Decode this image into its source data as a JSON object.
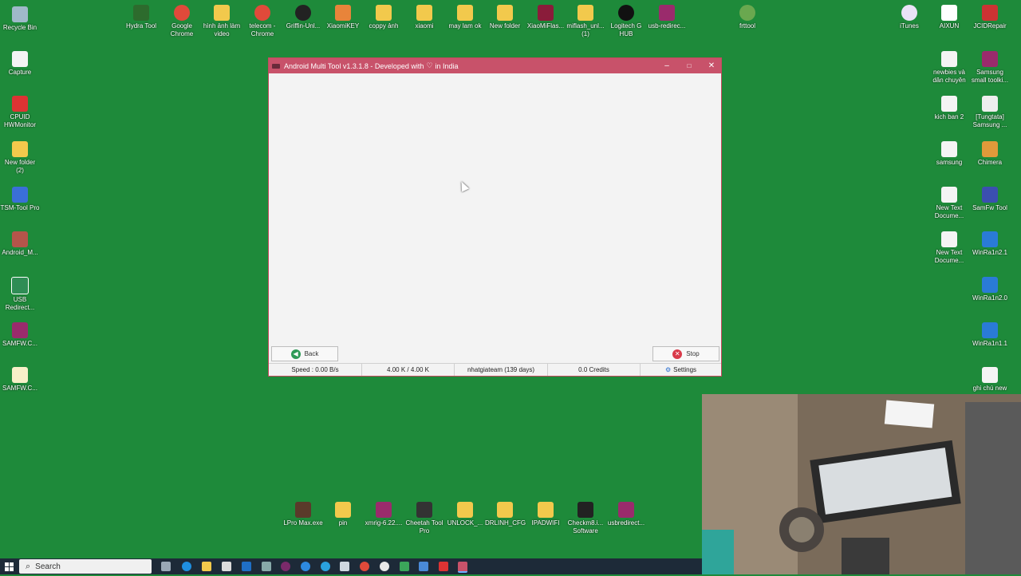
{
  "desktop": {
    "top_row": [
      "Hydra Tool",
      "Google Chrome",
      "hình ảnh làm video",
      "telecom - Chrome",
      "Griffin-Unl...",
      "XiaomiKEY",
      "coppy ảnh",
      "xiaomi",
      "may lam ok",
      "New folder",
      "XiaoMiFlas...",
      "miflash_unl... (1)",
      "Logitech G HUB",
      "usb-redirec...",
      "frttool"
    ],
    "left_col": [
      "Recycle Bin",
      "Capture",
      "CPUID HWMonitor",
      "New folder (2)",
      "TSM-Tool Pro",
      "Android_M...",
      "USB Redirect...",
      "SAMFW.C...",
      "SAMFW.C..."
    ],
    "right_col_a": [
      "iTunes",
      "newbies và dân chuyên",
      "kich ban 2",
      "samsung",
      "New Text Docume...",
      "New Text Docume..."
    ],
    "right_col_b": [
      "AIXUN",
      "JCIDRepair",
      "Samsung small toolki...",
      "[Tungtata] Samsung ...",
      "Chimera",
      "SamFw Tool",
      "WinRa1n2.1",
      "WinRa1n2.0",
      "WinRa1n1.1",
      "ghi chú new"
    ],
    "bottom_row": [
      "LPro Max.exe",
      "pin",
      "xmrig-6.22....",
      "Cheetah Tool Pro",
      "UNLOCK_...",
      "DRLINH_CFG",
      "IPADWIFI",
      "Checkm8.i... Software",
      "usbredirect..."
    ]
  },
  "window": {
    "title_prefix": "Android Multi Tool v1.3.1.8 - Developed with",
    "title_heart": "♡",
    "title_suffix": "in India",
    "minimize": "–",
    "maximize": "□",
    "close": "✕",
    "back_label": "Back",
    "stop_label": "Stop",
    "status": {
      "speed": "Speed : 0.00 B/s",
      "size": "4.00 K / 4.00 K",
      "user": "nhatgiateam (139 days)",
      "credits": "0.0 Credits",
      "settings": "Settings"
    }
  },
  "taskbar": {
    "search_placeholder": "Search"
  },
  "colors": {
    "desktop_bg": "#1e8a3a",
    "titlebar": "#c8526a",
    "back_icon": "#2e9a57",
    "stop_icon": "#d93a4a"
  }
}
